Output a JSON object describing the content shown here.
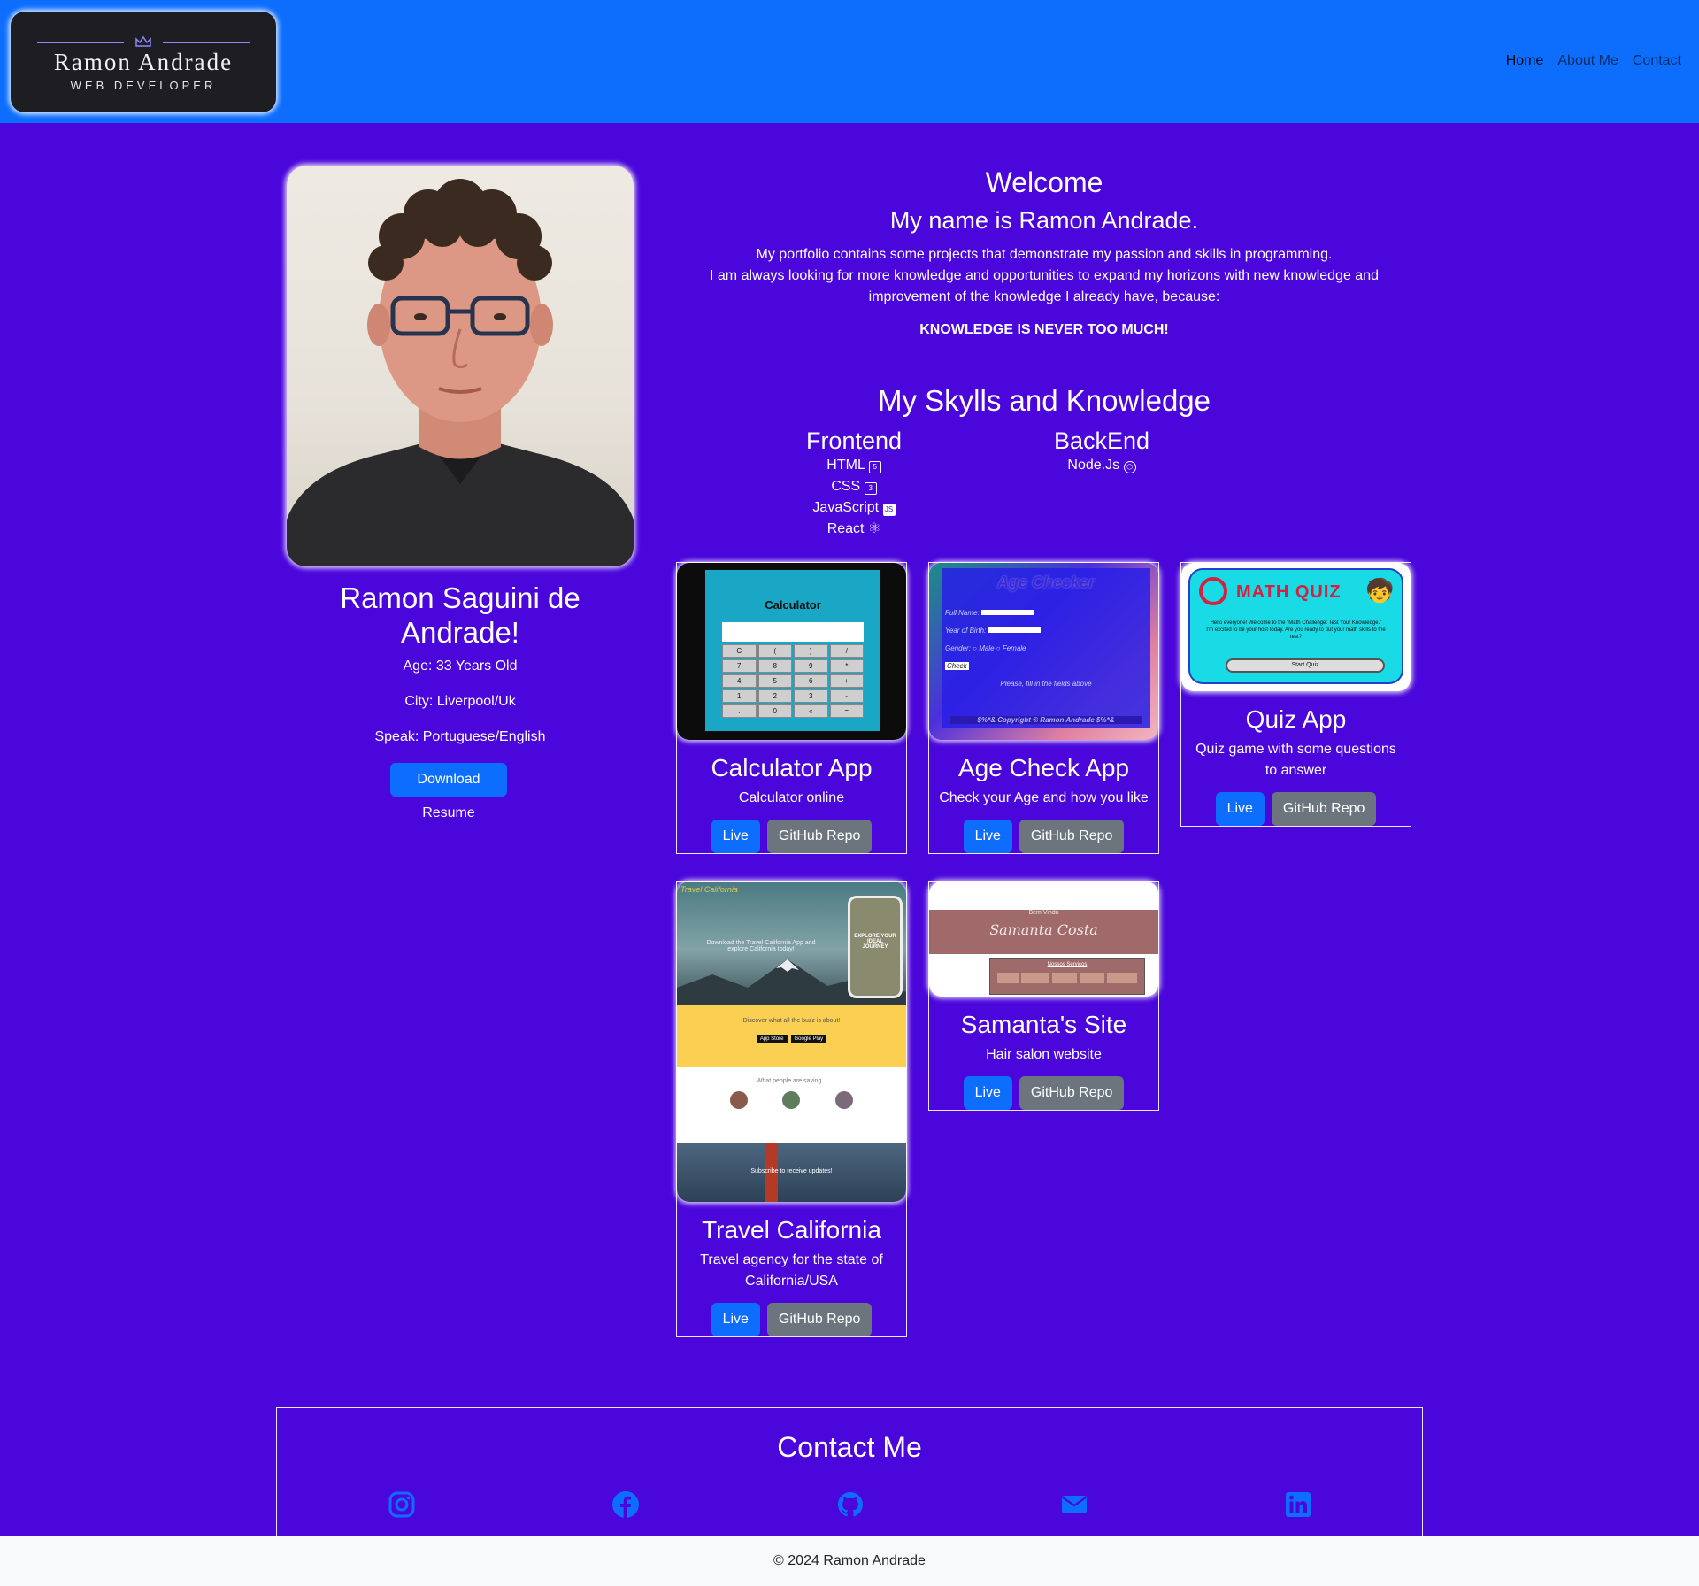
{
  "header": {
    "logo_title": "Ramon Andrade",
    "logo_subtitle": "WEB DEVELOPER",
    "nav": [
      "Home",
      "About Me",
      "Contact"
    ]
  },
  "profile": {
    "name": "Ramon Saguini de Andrade!",
    "age": "Age: 33 Years Old",
    "city": "City: Liverpool/Uk",
    "speak": "Speak: Portuguese/English",
    "resume_button": "Download Resume"
  },
  "welcome": {
    "title": "Welcome",
    "subtitle": "My name is Ramon Andrade.",
    "line1": "My portfolio contains some projects that demonstrate my passion and skills in programming.",
    "line2": "I am always looking for more knowledge and opportunities to expand my horizons with new knowledge and improvement of the knowledge I already have, because:",
    "motto": "KNOWLEDGE IS NEVER TOO MUCH!"
  },
  "skills": {
    "title": "My Skylls and Knowledge",
    "frontend_title": "Frontend",
    "frontend": [
      "HTML",
      "CSS",
      "JavaScript",
      "React"
    ],
    "backend_title": "BackEnd",
    "backend": [
      "Node.Js"
    ]
  },
  "projects": [
    {
      "title": "Calculator App",
      "description": "Calculator online",
      "live": "Live",
      "repo": "GitHub Repo"
    },
    {
      "title": "Age Check App",
      "description": "Check your Age and how you like",
      "live": "Live",
      "repo": "GitHub Repo"
    },
    {
      "title": "Quiz App",
      "description": "Quiz game with some questions to answer",
      "live": "Live",
      "repo": "GitHub Repo"
    },
    {
      "title": "Travel California",
      "description": "Travel agency for the state of California/USA",
      "live": "Live",
      "repo": "GitHub Repo"
    },
    {
      "title": "Samanta's Site",
      "description": "Hair salon website",
      "live": "Live",
      "repo": "GitHub Repo"
    }
  ],
  "screenshots": {
    "calculator_title": "Calculator",
    "calculator_keys": [
      "C",
      "(",
      ")",
      "/",
      "7",
      "8",
      "9",
      "*",
      "4",
      "5",
      "6",
      "+",
      "1",
      "2",
      "3",
      "-",
      ".",
      "0",
      "«",
      "="
    ],
    "age_title": "Age Checker",
    "age_full_name": "Full Name:",
    "age_year": "Year of Birth:",
    "age_gender": "Gender:",
    "age_male": "Male",
    "age_female": "Female",
    "age_check": "Check",
    "age_hint": "Please, fill in the fields above",
    "age_footer": "$%*& Copyright © Ramon Andrade $%*&",
    "quiz_logo": "MATH QUIZ",
    "quiz_text": "Hello everyone! Welcome to the \"Math Challenge: Test Your Knowledge.\" I'm excited to be your host today. Are you ready to put your math skills to the test?",
    "quiz_start": "Start Quiz",
    "travel_logo": "Travel California",
    "travel_hero": "Download the Travel California App and explore California today!",
    "travel_phone": "EXPLORE YOUR IDEAL JOURNEY",
    "travel_yellow": "Discover what all the buzz is about!",
    "travel_appstore": "App Store",
    "travel_googleplay": "Google Play",
    "travel_people": "What people are saying...",
    "travel_subscribe": "Subscribe to receive updates!",
    "samanta_welcome": "Bem Vindo",
    "samanta_name": "Samanta Costa",
    "samanta_services": "Nossos Serviços"
  },
  "contact": {
    "title": "Contact Me",
    "icons": [
      "instagram-icon",
      "facebook-icon",
      "github-icon",
      "email-icon",
      "linkedin-icon"
    ],
    "icon_color": "#0d6efd"
  },
  "footer": {
    "text": "© 2024 Ramon Andrade"
  },
  "colors": {
    "background": "#4a06db",
    "header": "#0d6efd",
    "primary": "#0d6efd",
    "secondary": "#6c757d",
    "footer": "#f8f9fa"
  }
}
